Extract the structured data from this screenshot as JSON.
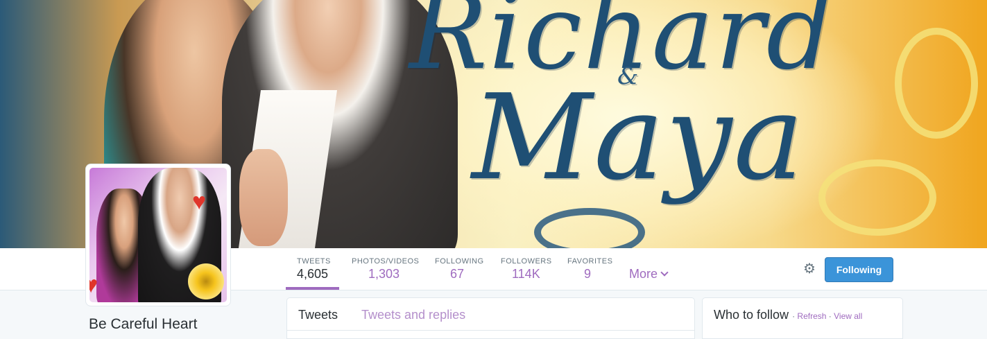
{
  "banner": {
    "line1": "Richard",
    "amp": "&",
    "line2": "Maya"
  },
  "profile": {
    "name": "Be Careful Heart"
  },
  "nav": {
    "stats": [
      {
        "label": "TWEETS",
        "value": "4,605",
        "active": true
      },
      {
        "label": "PHOTOS/VIDEOS",
        "value": "1,303",
        "active": false
      },
      {
        "label": "FOLLOWING",
        "value": "67",
        "active": false
      },
      {
        "label": "FOLLOWERS",
        "value": "114K",
        "active": false
      },
      {
        "label": "FAVORITES",
        "value": "9",
        "active": false
      }
    ],
    "more_label": "More",
    "follow_button": "Following",
    "gear_icon": "gear-icon"
  },
  "timeline": {
    "tabs": [
      {
        "label": "Tweets",
        "active": true
      },
      {
        "label": "Tweets and replies",
        "active": false
      }
    ]
  },
  "who_to_follow": {
    "title": "Who to follow",
    "sep": "·",
    "refresh": "Refresh",
    "view_all": "View all"
  },
  "colors": {
    "accent": "#9f6bbf",
    "button": "#3b94d9"
  }
}
